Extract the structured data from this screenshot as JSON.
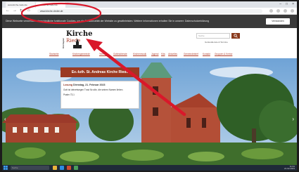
{
  "browser": {
    "tabs": [
      {
        "label": "www.kirche-rieder.de"
      },
      {
        "label": "www.kirche-rieder.de"
      }
    ],
    "new_tab_label": "+",
    "url": "www.kirche-rieder.de"
  },
  "cookie_banner": {
    "text": "Diese Webseite verwendet unterschiedliche funktionale Cookies, um die Funktionalität der Website zu gewährleisten. Weitere Informationen erhalten Sie in unserer: Datenschutzerklärung",
    "button_label": "Verstanden"
  },
  "site_header": {
    "logo_main": "Kirche",
    "logo_sub": "Riede",
    "logo_vertical": "Kirchspiel",
    "search_placeholder": "Suche",
    "header_link": "Gottesdienste & Termine"
  },
  "nav": {
    "items": [
      "Startseite",
      "Kirchengemeinde",
      "Termine",
      "Gottesdienste",
      "Kirchenmusik",
      "Jugend",
      "Kita",
      "Aktuelles",
      "Gemeindebrief",
      "Kontakt",
      "Gruppen & Kreise"
    ]
  },
  "hero": {
    "title": "Ev.-luth. St. Andreas Kirche Riede",
    "news_date_label": "Losung",
    "news_date": "Dienstag, 21. Februar 2023",
    "news_text": "Gott ist deinetwegen Trost für alle, die seinen Namen lieben.",
    "news_ref": "Psalm 73,1"
  },
  "taskbar": {
    "search_placeholder": "Suche",
    "time": "11:31",
    "date": "21.02.2023"
  },
  "colors": {
    "annotation": "#d9182a",
    "brand": "#9b3a22",
    "cookie_bg": "#3a3a3a"
  }
}
